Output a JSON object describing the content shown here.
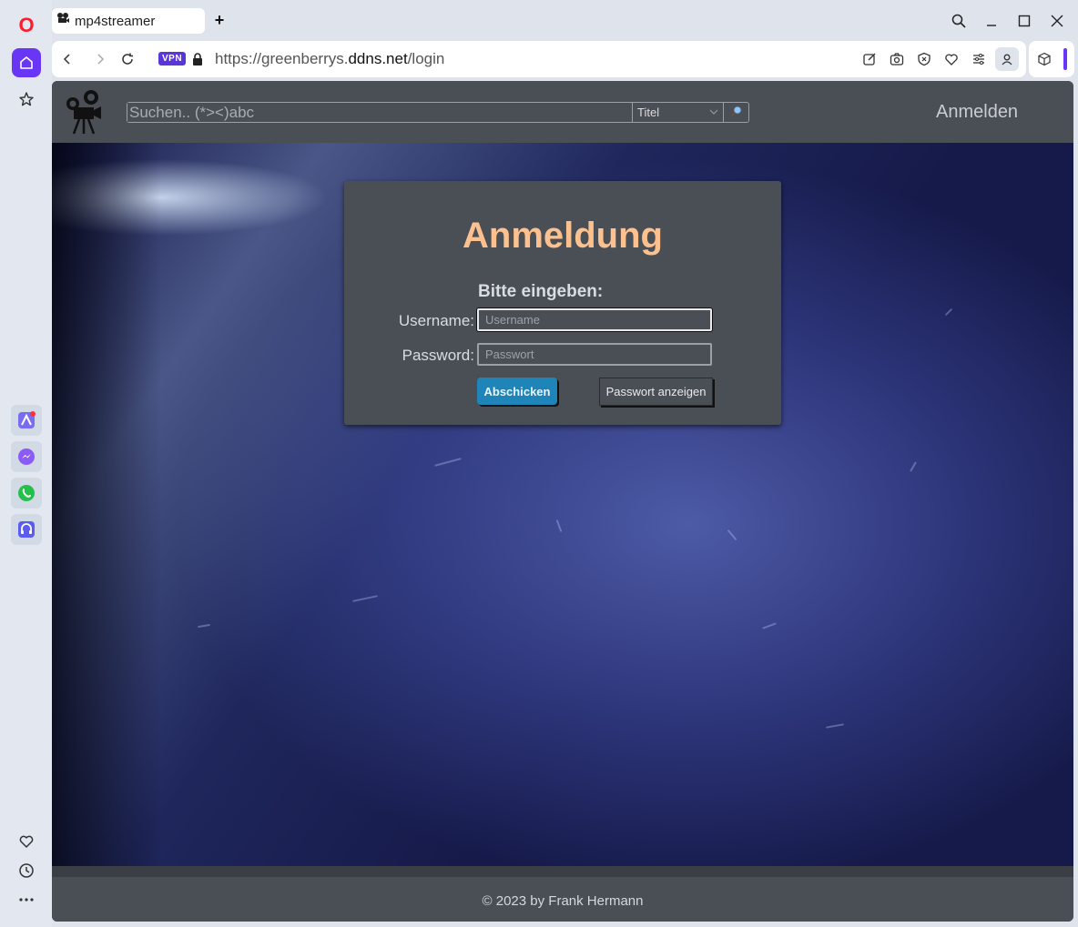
{
  "browser": {
    "tab": {
      "title": "mp4streamer",
      "icon": "film-projector-icon"
    },
    "new_tab_symbol": "+",
    "url": {
      "scheme_host_prefix": "https://greenberrys.",
      "domain": "ddns.net",
      "path": "/login"
    },
    "vpn_badge": "VPN",
    "sidebar": {
      "logo": "O",
      "items": [
        "home-icon",
        "star-icon",
        "aria-icon",
        "messenger-icon",
        "whatsapp-icon",
        "music-player-icon",
        "heart-icon",
        "history-icon",
        "more-icon"
      ]
    }
  },
  "site": {
    "search": {
      "placeholder": "Suchen.. (*><)abc",
      "filter_selected": "Titel",
      "button_icon": "magnifier-icon"
    },
    "login_link": "Anmelden",
    "footer": "© 2023 by Frank Hermann"
  },
  "login": {
    "title": "Anmeldung",
    "subtitle": "Bitte eingeben:",
    "username_label": "Username:",
    "username_placeholder": "Username",
    "password_label": "Password:",
    "password_placeholder": "Passwort",
    "submit_label": "Abschicken",
    "show_password_label": "Passwort anzeigen"
  },
  "colors": {
    "title_accent": "#fcc18e",
    "submit_button": "#1f84b8",
    "opera_brand": "#ff1b2d",
    "sidebar_active": "#6a36f5"
  }
}
